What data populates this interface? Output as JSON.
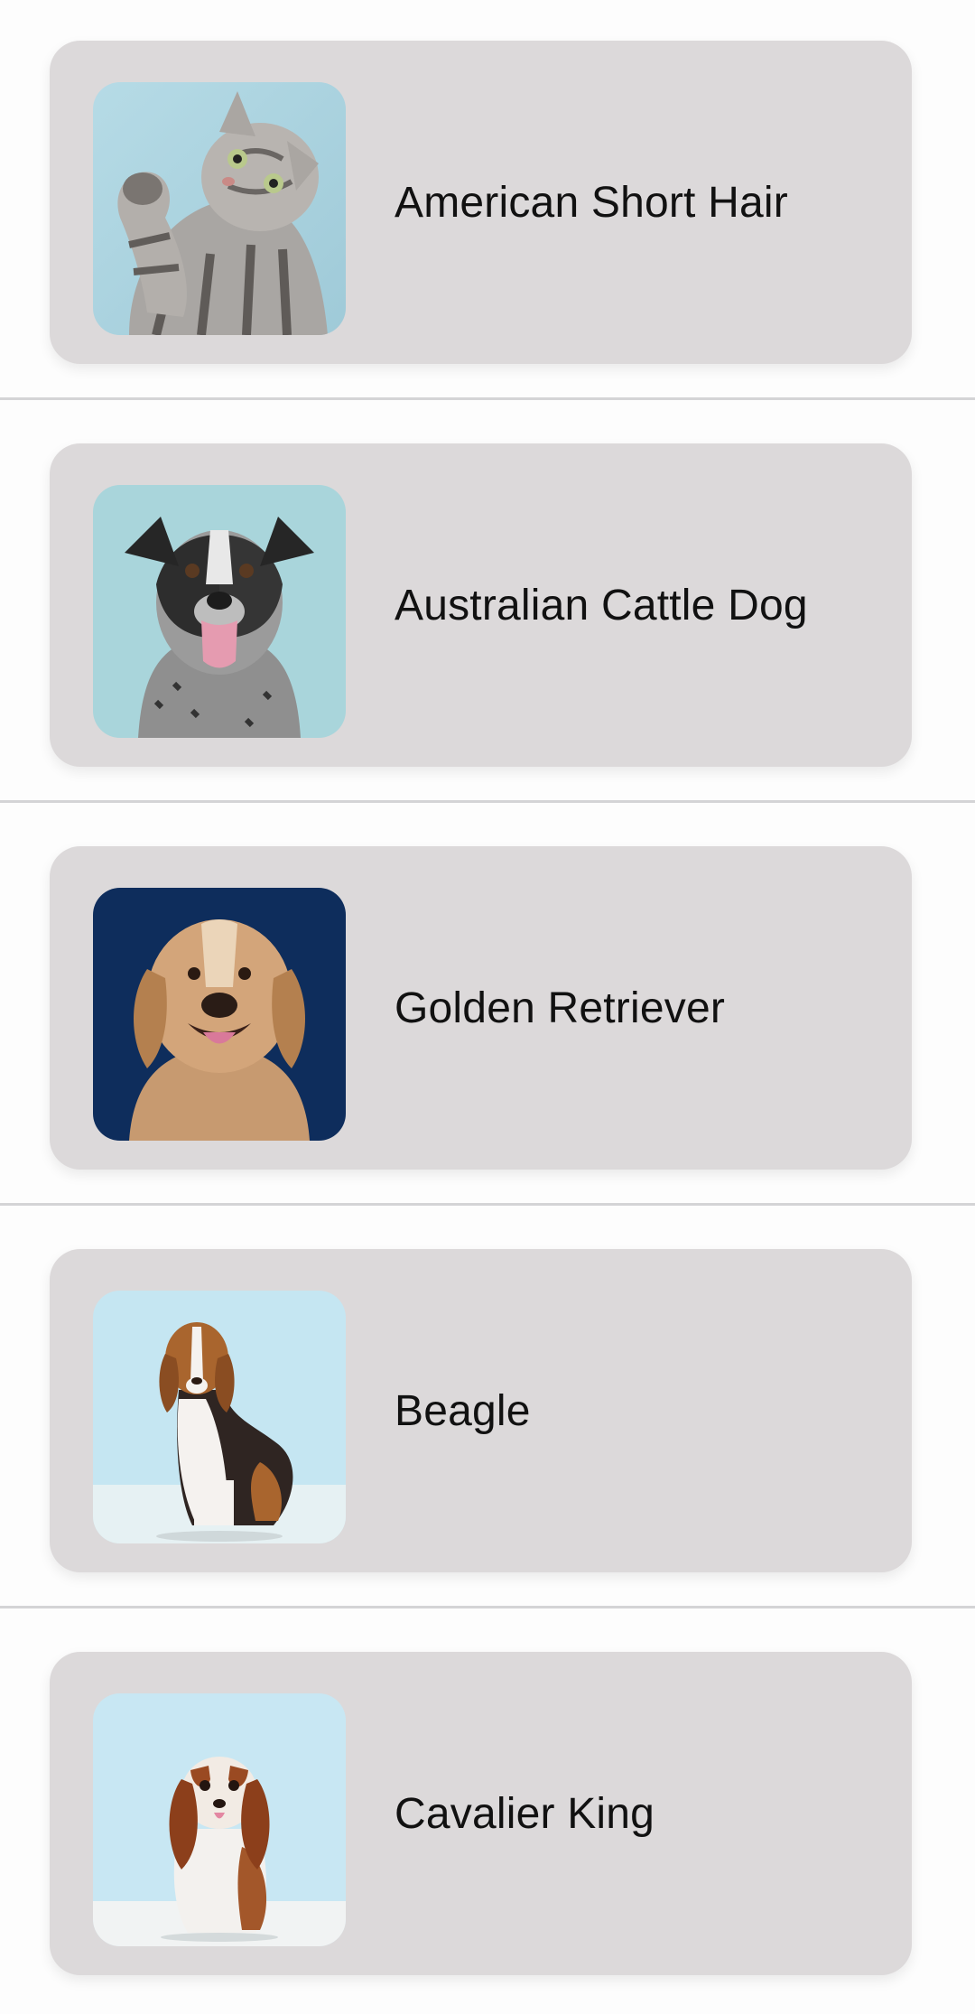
{
  "breeds": [
    {
      "name": "American Short Hair",
      "icon": "cat-photo-icon"
    },
    {
      "name": "Australian Cattle Dog",
      "icon": "dog-photo-icon"
    },
    {
      "name": "Golden Retriever",
      "icon": "dog-photo-icon"
    },
    {
      "name": "Beagle",
      "icon": "dog-photo-icon"
    },
    {
      "name": "Cavalier King",
      "icon": "dog-photo-icon"
    }
  ],
  "colors": {
    "card_background": "#dcd9da",
    "page_background": "#fdfdfd",
    "divider": "#d4d4d6",
    "text": "#111111"
  }
}
